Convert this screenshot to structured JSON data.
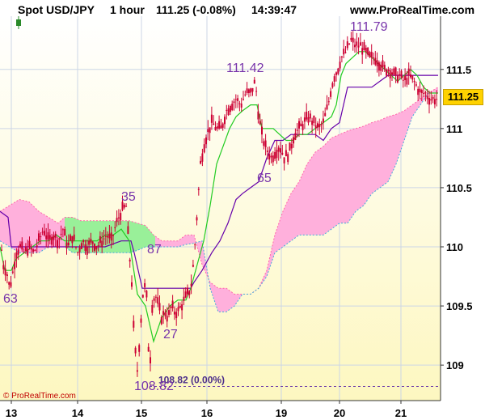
{
  "header": {
    "symbol": "Spot USD/JPY",
    "timeframe": "1 hour",
    "price_change": "111.25 (-0.08%)",
    "time": "14:39:47",
    "site": "www.ProRealTime.com"
  },
  "copyright": "© ProRealTime.com",
  "colors": {
    "candle": "#cc0033",
    "tenkan": "#22cc22",
    "kijun": "#6600aa",
    "cloud_bull": "#99f099",
    "cloud_bear": "#ffb0dc",
    "label": "#7733aa",
    "bg_top": "#ffffff",
    "bg_bottom": "#fdf7c0"
  },
  "chart_data": {
    "type": "candlestick",
    "instrument": "Spot USD/JPY",
    "interval": "1 hour",
    "ylim": [
      108.7,
      111.95
    ],
    "x_tick_labels": [
      "13",
      "14",
      "15",
      "16",
      "19",
      "20",
      "21"
    ],
    "y_tick_labels": [
      "109",
      "109.5",
      "110",
      "110.5",
      "111",
      "111.5"
    ],
    "last_price": "111.25",
    "low_line_label": "108.82 (0.00%)",
    "low_line_value": 108.82,
    "annotations": [
      {
        "text": "63",
        "value": 109.63
      },
      {
        "text": "35",
        "value": 110.35
      },
      {
        "text": "87",
        "value": 109.87
      },
      {
        "text": "27",
        "value": 109.27
      },
      {
        "text": "108.82",
        "value": 108.82
      },
      {
        "text": "111.42",
        "value": 111.42
      },
      {
        "text": "65",
        "value": 110.65
      },
      {
        "text": "111.79",
        "value": 111.79
      }
    ],
    "price_path": [
      [
        0,
        110.1
      ],
      [
        4,
        109.85
      ],
      [
        8,
        109.8
      ],
      [
        12,
        109.65
      ],
      [
        15,
        109.75
      ],
      [
        20,
        109.95
      ],
      [
        25,
        110.0
      ],
      [
        30,
        109.95
      ],
      [
        36,
        110.0
      ],
      [
        42,
        109.95
      ],
      [
        48,
        110.05
      ],
      [
        54,
        110.15
      ],
      [
        60,
        110.05
      ],
      [
        66,
        110.1
      ],
      [
        72,
        110.05
      ],
      [
        78,
        110.15
      ],
      [
        84,
        110.0
      ],
      [
        90,
        110.1
      ],
      [
        96,
        109.95
      ],
      [
        102,
        110.05
      ],
      [
        108,
        110.0
      ],
      [
        114,
        110.05
      ],
      [
        120,
        110.0
      ],
      [
        126,
        110.05
      ],
      [
        132,
        110.1
      ],
      [
        138,
        110.05
      ],
      [
        144,
        110.2
      ],
      [
        150,
        110.3
      ],
      [
        156,
        110.35
      ],
      [
        160,
        109.95
      ],
      [
        163,
        109.7
      ],
      [
        166,
        109.2
      ],
      [
        170,
        108.95
      ],
      [
        174,
        109.35
      ],
      [
        178,
        109.7
      ],
      [
        182,
        109.55
      ],
      [
        185,
        108.85
      ],
      [
        188,
        109.5
      ],
      [
        192,
        109.6
      ],
      [
        196,
        109.5
      ],
      [
        200,
        109.4
      ],
      [
        204,
        109.45
      ],
      [
        208,
        109.4
      ],
      [
        212,
        109.5
      ],
      [
        216,
        109.45
      ],
      [
        220,
        109.45
      ],
      [
        224,
        109.5
      ],
      [
        228,
        109.55
      ],
      [
        232,
        109.6
      ],
      [
        236,
        109.65
      ],
      [
        240,
        109.9
      ],
      [
        244,
        110.3
      ],
      [
        248,
        110.7
      ],
      [
        252,
        110.85
      ],
      [
        256,
        110.95
      ],
      [
        262,
        111.05
      ],
      [
        268,
        111.0
      ],
      [
        274,
        111.0
      ],
      [
        280,
        111.15
      ],
      [
        286,
        111.2
      ],
      [
        292,
        111.25
      ],
      [
        298,
        111.2
      ],
      [
        304,
        111.3
      ],
      [
        310,
        111.3
      ],
      [
        316,
        111.4
      ],
      [
        320,
        111.1
      ],
      [
        324,
        110.95
      ],
      [
        328,
        110.85
      ],
      [
        332,
        110.8
      ],
      [
        336,
        110.75
      ],
      [
        340,
        110.8
      ],
      [
        346,
        110.85
      ],
      [
        352,
        110.75
      ],
      [
        358,
        110.8
      ],
      [
        364,
        110.95
      ],
      [
        370,
        111.0
      ],
      [
        376,
        111.05
      ],
      [
        382,
        111.1
      ],
      [
        388,
        111.05
      ],
      [
        394,
        111.0
      ],
      [
        400,
        111.05
      ],
      [
        406,
        111.2
      ],
      [
        410,
        111.35
      ],
      [
        414,
        111.45
      ],
      [
        418,
        111.5
      ],
      [
        422,
        111.6
      ],
      [
        428,
        111.65
      ],
      [
        434,
        111.75
      ],
      [
        440,
        111.7
      ],
      [
        446,
        111.7
      ],
      [
        452,
        111.65
      ],
      [
        458,
        111.6
      ],
      [
        464,
        111.6
      ],
      [
        470,
        111.55
      ],
      [
        476,
        111.5
      ],
      [
        482,
        111.5
      ],
      [
        488,
        111.45
      ],
      [
        494,
        111.45
      ],
      [
        500,
        111.4
      ],
      [
        506,
        111.45
      ],
      [
        512,
        111.4
      ],
      [
        516,
        111.35
      ],
      [
        520,
        111.3
      ],
      [
        526,
        111.3
      ],
      [
        532,
        111.25
      ],
      [
        538,
        111.25
      ],
      [
        542,
        111.25
      ]
    ],
    "tenkan_path": [
      [
        0,
        110.0
      ],
      [
        6,
        109.8
      ],
      [
        14,
        109.8
      ],
      [
        20,
        109.9
      ],
      [
        30,
        109.95
      ],
      [
        40,
        110.0
      ],
      [
        50,
        110.05
      ],
      [
        60,
        110.05
      ],
      [
        70,
        110.1
      ],
      [
        80,
        110.05
      ],
      [
        90,
        110.05
      ],
      [
        100,
        110.05
      ],
      [
        110,
        110.05
      ],
      [
        120,
        110.05
      ],
      [
        130,
        110.1
      ],
      [
        140,
        110.1
      ],
      [
        150,
        110.15
      ],
      [
        160,
        110.05
      ],
      [
        170,
        109.6
      ],
      [
        180,
        109.5
      ],
      [
        190,
        109.2
      ],
      [
        200,
        109.4
      ],
      [
        210,
        109.5
      ],
      [
        220,
        109.55
      ],
      [
        230,
        109.55
      ],
      [
        236,
        109.65
      ],
      [
        244,
        109.85
      ],
      [
        252,
        110.05
      ],
      [
        260,
        110.35
      ],
      [
        268,
        110.7
      ],
      [
        276,
        110.85
      ],
      [
        284,
        111.0
      ],
      [
        292,
        111.1
      ],
      [
        300,
        111.15
      ],
      [
        310,
        111.2
      ],
      [
        318,
        111.2
      ],
      [
        324,
        111.0
      ],
      [
        330,
        111.0
      ],
      [
        338,
        111.0
      ],
      [
        346,
        110.95
      ],
      [
        354,
        110.9
      ],
      [
        362,
        110.9
      ],
      [
        370,
        110.95
      ],
      [
        380,
        110.95
      ],
      [
        390,
        111.0
      ],
      [
        400,
        111.05
      ],
      [
        410,
        111.1
      ],
      [
        416,
        111.2
      ],
      [
        422,
        111.45
      ],
      [
        428,
        111.55
      ],
      [
        436,
        111.6
      ],
      [
        444,
        111.65
      ],
      [
        452,
        111.65
      ],
      [
        460,
        111.6
      ],
      [
        468,
        111.55
      ],
      [
        476,
        111.5
      ],
      [
        484,
        111.45
      ],
      [
        492,
        111.4
      ],
      [
        500,
        111.45
      ],
      [
        508,
        111.5
      ],
      [
        516,
        111.45
      ],
      [
        524,
        111.35
      ],
      [
        532,
        111.3
      ],
      [
        542,
        111.3
      ]
    ],
    "kijun_path": [
      [
        0,
        110.3
      ],
      [
        10,
        110.25
      ],
      [
        14,
        110.0
      ],
      [
        30,
        110.0
      ],
      [
        50,
        110.0
      ],
      [
        70,
        110.0
      ],
      [
        90,
        110.0
      ],
      [
        110,
        110.0
      ],
      [
        130,
        110.0
      ],
      [
        150,
        110.05
      ],
      [
        162,
        110.05
      ],
      [
        166,
        109.95
      ],
      [
        176,
        109.65
      ],
      [
        200,
        109.65
      ],
      [
        236,
        109.65
      ],
      [
        240,
        109.7
      ],
      [
        250,
        109.8
      ],
      [
        262,
        109.95
      ],
      [
        272,
        110.05
      ],
      [
        282,
        110.2
      ],
      [
        292,
        110.4
      ],
      [
        300,
        110.45
      ],
      [
        310,
        110.5
      ],
      [
        320,
        110.55
      ],
      [
        330,
        110.75
      ],
      [
        340,
        110.9
      ],
      [
        350,
        110.9
      ],
      [
        360,
        110.95
      ],
      [
        370,
        110.95
      ],
      [
        380,
        110.95
      ],
      [
        390,
        110.95
      ],
      [
        400,
        110.9
      ],
      [
        410,
        111.0
      ],
      [
        420,
        111.05
      ],
      [
        430,
        111.35
      ],
      [
        440,
        111.35
      ],
      [
        450,
        111.35
      ],
      [
        460,
        111.35
      ],
      [
        470,
        111.4
      ],
      [
        480,
        111.45
      ],
      [
        490,
        111.45
      ],
      [
        500,
        111.45
      ],
      [
        510,
        111.45
      ],
      [
        520,
        111.45
      ],
      [
        530,
        111.45
      ],
      [
        542,
        111.45
      ]
    ],
    "cloud_span_a": [
      [
        0,
        110.3
      ],
      [
        12,
        110.35
      ],
      [
        24,
        110.4
      ],
      [
        36,
        110.38
      ],
      [
        48,
        110.3
      ],
      [
        60,
        110.25
      ],
      [
        72,
        110.2
      ],
      [
        80,
        110.25
      ],
      [
        90,
        110.25
      ],
      [
        100,
        110.22
      ],
      [
        110,
        110.22
      ],
      [
        120,
        110.22
      ],
      [
        130,
        110.22
      ],
      [
        140,
        110.22
      ],
      [
        150,
        110.22
      ],
      [
        160,
        110.22
      ],
      [
        170,
        110.2
      ],
      [
        180,
        110.18
      ],
      [
        190,
        110.1
      ],
      [
        200,
        110.05
      ],
      [
        210,
        110.05
      ],
      [
        220,
        110.05
      ],
      [
        230,
        110.1
      ],
      [
        240,
        110.1
      ],
      [
        250,
        109.85
      ],
      [
        260,
        109.7
      ],
      [
        270,
        109.65
      ],
      [
        280,
        109.65
      ],
      [
        290,
        109.6
      ],
      [
        300,
        109.6
      ],
      [
        310,
        109.6
      ],
      [
        320,
        109.65
      ],
      [
        330,
        109.8
      ],
      [
        340,
        110.1
      ],
      [
        350,
        110.3
      ],
      [
        360,
        110.45
      ],
      [
        370,
        110.55
      ],
      [
        380,
        110.7
      ],
      [
        390,
        110.8
      ],
      [
        400,
        110.85
      ],
      [
        410,
        110.92
      ],
      [
        420,
        110.95
      ],
      [
        430,
        110.98
      ],
      [
        440,
        111.0
      ],
      [
        450,
        111.02
      ],
      [
        460,
        111.05
      ],
      [
        470,
        111.07
      ],
      [
        480,
        111.1
      ],
      [
        490,
        111.12
      ],
      [
        500,
        111.15
      ],
      [
        510,
        111.2
      ],
      [
        520,
        111.25
      ],
      [
        530,
        111.3
      ],
      [
        542,
        111.35
      ]
    ],
    "cloud_span_b": [
      [
        0,
        110.05
      ],
      [
        12,
        110.0
      ],
      [
        24,
        109.95
      ],
      [
        36,
        109.95
      ],
      [
        48,
        109.95
      ],
      [
        60,
        110.0
      ],
      [
        72,
        110.0
      ],
      [
        80,
        110.0
      ],
      [
        90,
        109.95
      ],
      [
        100,
        109.95
      ],
      [
        110,
        109.95
      ],
      [
        120,
        109.95
      ],
      [
        130,
        109.95
      ],
      [
        140,
        109.95
      ],
      [
        150,
        109.95
      ],
      [
        160,
        109.95
      ],
      [
        170,
        109.97
      ],
      [
        180,
        110.0
      ],
      [
        190,
        110.0
      ],
      [
        200,
        110.0
      ],
      [
        210,
        110.0
      ],
      [
        220,
        110.0
      ],
      [
        230,
        110.02
      ],
      [
        240,
        110.03
      ],
      [
        250,
        110.05
      ],
      [
        260,
        109.65
      ],
      [
        270,
        109.45
      ],
      [
        280,
        109.45
      ],
      [
        290,
        109.5
      ],
      [
        300,
        109.6
      ],
      [
        310,
        109.6
      ],
      [
        320,
        109.65
      ],
      [
        330,
        109.75
      ],
      [
        340,
        109.95
      ],
      [
        350,
        110.0
      ],
      [
        360,
        110.05
      ],
      [
        370,
        110.1
      ],
      [
        380,
        110.1
      ],
      [
        390,
        110.1
      ],
      [
        400,
        110.1
      ],
      [
        410,
        110.15
      ],
      [
        420,
        110.2
      ],
      [
        430,
        110.2
      ],
      [
        440,
        110.3
      ],
      [
        450,
        110.35
      ],
      [
        460,
        110.45
      ],
      [
        470,
        110.5
      ],
      [
        480,
        110.55
      ],
      [
        490,
        110.7
      ],
      [
        500,
        110.9
      ],
      [
        510,
        111.1
      ],
      [
        520,
        111.2
      ],
      [
        530,
        111.3
      ],
      [
        542,
        111.3
      ]
    ]
  }
}
